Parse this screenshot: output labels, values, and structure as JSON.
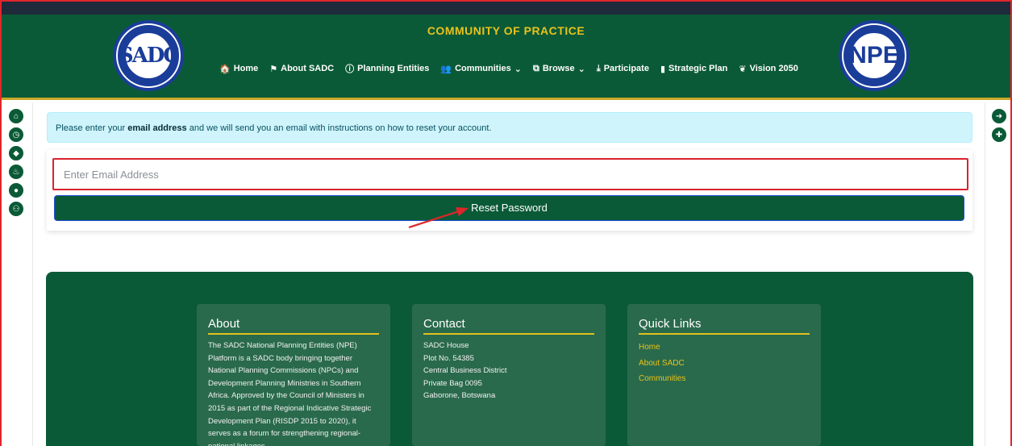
{
  "header": {
    "title": "COMMUNITY OF PRACTICE",
    "sadc_logo_text": "SADC",
    "npe_logo_text": "NPE",
    "nav": [
      {
        "icon": "home-icon",
        "glyph": "🏠",
        "label": "Home"
      },
      {
        "icon": "flag-icon",
        "glyph": "⚑",
        "label": "About SADC"
      },
      {
        "icon": "info-icon",
        "glyph": "ⓘ",
        "label": "Planning Entities"
      },
      {
        "icon": "users-icon",
        "glyph": "👥",
        "label": "Communities"
      },
      {
        "icon": "browse-icon",
        "glyph": "⧉",
        "label": "Browse"
      },
      {
        "icon": "download-icon",
        "glyph": "⤓",
        "label": "Participate"
      },
      {
        "icon": "bar-chart-icon",
        "glyph": "▮",
        "label": "Strategic Plan"
      },
      {
        "icon": "leaf-icon",
        "glyph": "❦",
        "label": "Vision 2050"
      }
    ],
    "dropdown_indicator": "⌄"
  },
  "left_rail": [
    {
      "icon": "home-icon",
      "glyph": "⌂"
    },
    {
      "icon": "clock-icon",
      "glyph": "◷"
    },
    {
      "icon": "tags-icon",
      "glyph": "◆"
    },
    {
      "icon": "fire-icon",
      "glyph": "♨"
    },
    {
      "icon": "user-icon",
      "glyph": "●"
    },
    {
      "icon": "users-icon",
      "glyph": "⚇"
    }
  ],
  "right_rail": [
    {
      "icon": "sign-in-icon",
      "glyph": "➜"
    },
    {
      "icon": "user-plus-icon",
      "glyph": "✚"
    }
  ],
  "alert": {
    "prefix": "Please enter your ",
    "bold": "email address",
    "suffix": " and we will send you an email with instructions on how to reset your account."
  },
  "form": {
    "email_placeholder": "Enter Email Address",
    "email_value": "",
    "submit_label": "Reset Password"
  },
  "footer": {
    "about": {
      "heading": "About",
      "text": "The SADC National Planning Entities (NPE) Platform is a SADC body bringing together National Planning Commissions (NPCs) and Development Planning Ministries in Southern Africa. Approved by the Council of Ministers in 2015 as part of the Regional Indicative Strategic Development Plan (RISDP 2015 to 2020), it serves as a forum for strengthening regional-national linkages."
    },
    "contact": {
      "heading": "Contact",
      "lines": [
        "SADC House",
        "Plot No. 54385",
        "Central Business District",
        "Private Bag 0095",
        "Gaborone, Botswana"
      ]
    },
    "quick_links": {
      "heading": "Quick Links",
      "links": [
        "Home",
        "About SADC",
        "Communities"
      ]
    }
  },
  "colors": {
    "brand_green": "#0b5a37",
    "accent_gold": "#e8c21c",
    "highlight_red": "#d9232d"
  }
}
